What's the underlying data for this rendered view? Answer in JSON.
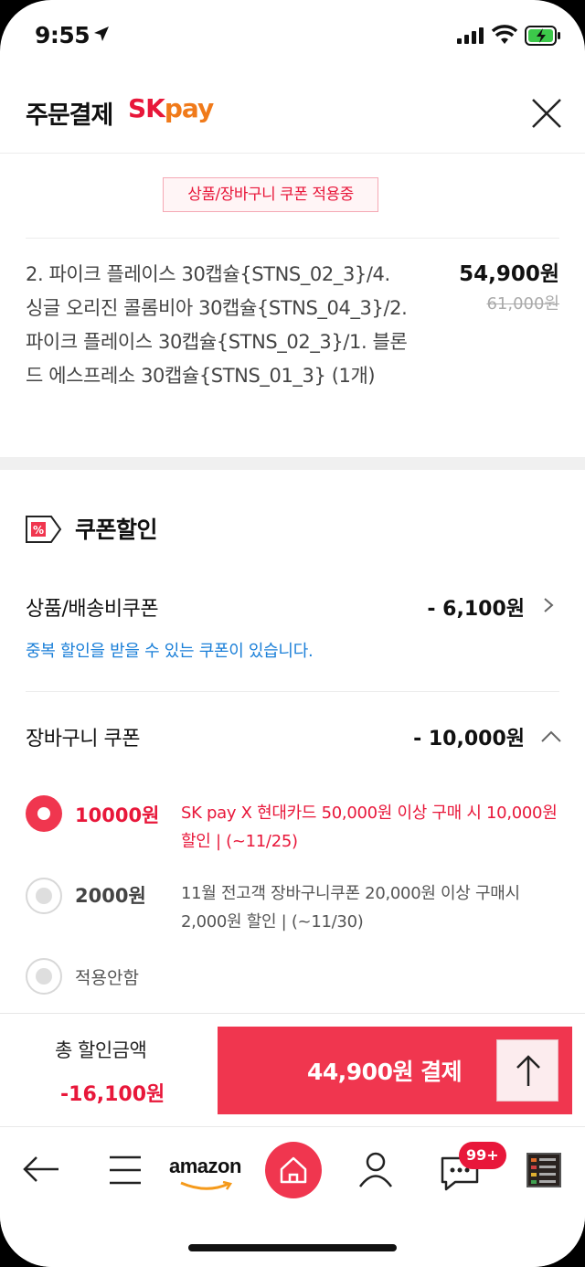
{
  "status_bar": {
    "time": "9:55"
  },
  "header": {
    "title": "주문결제",
    "brand_sk": "SK",
    "brand_pay": "pay"
  },
  "product": {
    "coupon_applied_tag": "상품/장바구니 쿠폰 적용중",
    "name": "2. 파이크 플레이스 30캡슐{STNS_02_3}/4. 싱글 오리진 콜롬비아 30캡슐{STNS_04_3}/2. 파이크 플레이스 30캡슐{STNS_02_3}/1. 블론드 에스프레소 30캡슐{STNS_01_3} (1개)",
    "price": "54,900원",
    "original_price": "61,000원"
  },
  "coupon_section": {
    "title": "쿠폰할인",
    "product_coupon": {
      "label": "상품/배송비쿠폰",
      "value": "- 6,100원"
    },
    "duplicate_note": "중복 할인을 받을 수 있는 쿠폰이 있습니다.",
    "cart_coupon": {
      "label": "장바구니 쿠폰",
      "value": "- 10,000원"
    },
    "options": [
      {
        "amount": "10000원",
        "desc": "SK pay X 현대카드 50,000원 이상 구매 시 10,000원 할인 | (~11/25)",
        "selected": true
      },
      {
        "amount": "2000원",
        "desc": "11월 전고객 장바구니쿠폰 20,000원 이상 구매시 2,000원 할인 | (~11/30)",
        "selected": false
      },
      {
        "amount": "적용안함",
        "selected": false
      }
    ]
  },
  "pay_bar": {
    "total_label": "총 할인금액",
    "total_value": "-16,100원",
    "pay_button": "44,900원 결제"
  },
  "bottom_nav": {
    "amazon_label": "amazon",
    "badge": "99+"
  },
  "colors": {
    "accent": "#f0364f",
    "link": "#1a7fd8",
    "sk_red": "#e8173a",
    "sk_orange": "#f07a1a"
  }
}
